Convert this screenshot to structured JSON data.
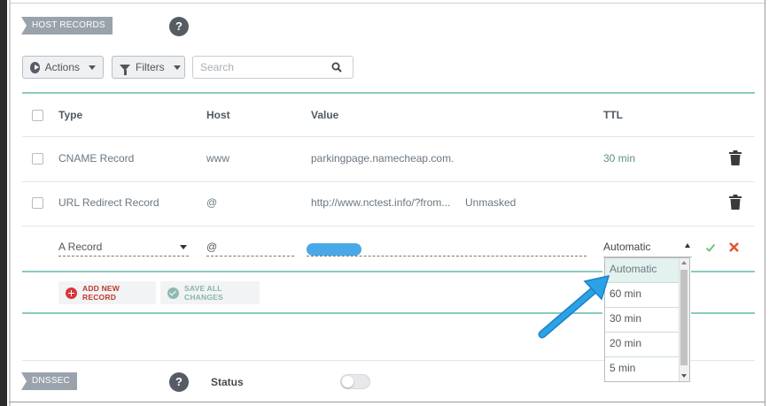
{
  "sections": {
    "host_records_label": "HOST RECORDS",
    "dnssec_label": "DNSSEC",
    "help_glyph": "?"
  },
  "toolbar": {
    "actions_label": "Actions",
    "filters_label": "Filters",
    "search_placeholder": "Search"
  },
  "table": {
    "headers": {
      "type": "Type",
      "host": "Host",
      "value": "Value",
      "ttl": "TTL"
    },
    "rows": [
      {
        "type": "CNAME Record",
        "host": "www",
        "value": "parkingpage.namecheap.com.",
        "extra": "",
        "ttl": "30 min"
      },
      {
        "type": "URL Redirect Record",
        "host": "@",
        "value": "http://www.nctest.info/?from...",
        "extra": "Unmasked",
        "ttl": ""
      }
    ],
    "edit_row": {
      "type": "A Record",
      "host": "@",
      "ttl_selected": "Automatic"
    }
  },
  "actions": {
    "add_new_record": "ADD NEW RECORD",
    "save_all_changes": "SAVE ALL CHANGES"
  },
  "ttl_dropdown": {
    "options": [
      "Automatic",
      "60 min",
      "30 min",
      "20 min",
      "5 min"
    ],
    "selected": "Automatic"
  },
  "dnssec": {
    "status_label": "Status",
    "enabled": false
  },
  "colors": {
    "accent_teal": "#8ccac0",
    "delete_red": "#d8363a",
    "annotation_arrow": "#2aa3e6",
    "tag_gray": "#9aa3ab"
  },
  "icons": [
    "play-icon",
    "funnel-icon",
    "search-icon",
    "trash-icon",
    "check-icon",
    "close-icon",
    "plus-icon",
    "save-check-icon",
    "help-icon"
  ]
}
